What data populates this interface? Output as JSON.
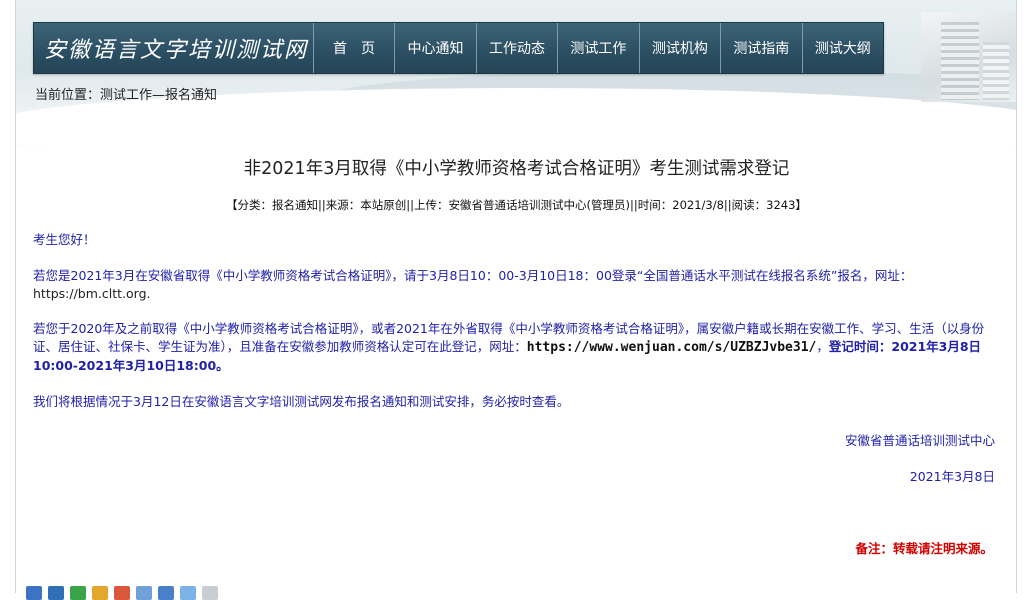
{
  "header": {
    "logo_text": "安徽语言文字培训测试网",
    "nav": [
      {
        "label": "首　页"
      },
      {
        "label": "中心通知"
      },
      {
        "label": "工作动态"
      },
      {
        "label": "测试工作"
      },
      {
        "label": "测试机构"
      },
      {
        "label": "测试指南"
      },
      {
        "label": "测试大纲"
      }
    ]
  },
  "breadcrumb": "当前位置：测试工作—报名通知",
  "article": {
    "title": "非2021年3月取得《中小学教师资格考试合格证明》考生测试需求登记",
    "meta": "【分类：报名通知||来源：本站原创||上传：安徽省普通话培训测试中心(管理员)||时间：2021/3/8||阅读：3243】",
    "greeting": "考生您好！",
    "p2_text": "若您是2021年3月在安徽省取得《中小学教师资格考试合格证明》，请于3月8日10：00-3月10日18：00登录“全国普通话水平测试在线报名系统”报名，网址：",
    "p2_url": "https://bm.cltt.org.",
    "p3_text": "若您于2020年及之前取得《中小学教师资格考试合格证明》，或者2021年在外省取得《中小学教师资格考试合格证明》，属安徽户籍或长期在安徽工作、学习、生活（以身份证、居住证、社保卡、学生证为准），且准备在安徽参加教师资格认定可在此登记，网址：",
    "p3_url": "https://www.wenjuan.com/s/UZBZJvbe31/",
    "p3_comma": "，",
    "p3_time": "登记时间：2021年3月8日10:00-2021年3月10日18:00。",
    "p4_text": "我们将根据情况于3月12日在安徽语言文字培训测试网发布报名通知和测试安排，务必按时查看。",
    "sign_org": "安徽省普通话培训测试中心",
    "sign_date": "2021年3月8日",
    "note": "备注：转载请注明来源。"
  },
  "colors": {
    "nav_bg": "#2b4e62",
    "content_text": "#1f1fa8",
    "note_red": "#d40000"
  }
}
